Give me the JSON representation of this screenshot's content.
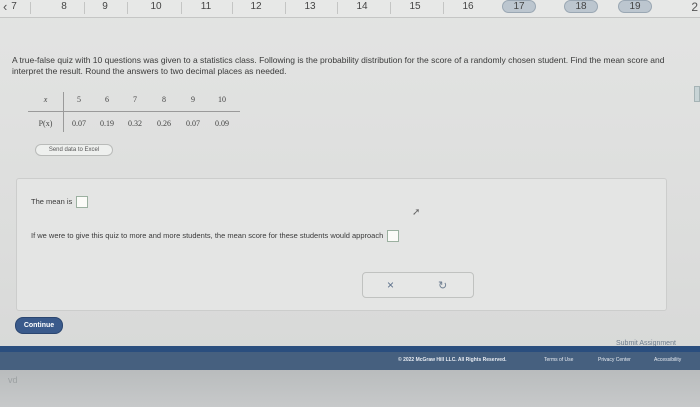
{
  "nav": {
    "prev_glyph": "‹",
    "items": [
      {
        "label": "7",
        "highlight": false
      },
      {
        "label": "8",
        "highlight": false
      },
      {
        "label": "9",
        "highlight": false
      },
      {
        "label": "10",
        "highlight": false
      },
      {
        "label": "11",
        "highlight": false
      },
      {
        "label": "12",
        "highlight": false
      },
      {
        "label": "13",
        "highlight": false
      },
      {
        "label": "14",
        "highlight": false
      },
      {
        "label": "15",
        "highlight": false
      },
      {
        "label": "16",
        "highlight": false
      },
      {
        "label": "17",
        "highlight": true
      },
      {
        "label": "18",
        "highlight": true
      },
      {
        "label": "19",
        "highlight": true
      }
    ],
    "next_glyph": "2"
  },
  "question": {
    "text": "A true-false quiz with 10 questions was given to a statistics class. Following is the probability distribution for the score of a randomly chosen student. Find the mean score and interpret the result. Round the answers to two decimal places as needed."
  },
  "table": {
    "x_label": "x",
    "p_label": "P(x)",
    "x_values": [
      "5",
      "6",
      "7",
      "8",
      "9",
      "10"
    ],
    "p_values": [
      "0.07",
      "0.19",
      "0.32",
      "0.26",
      "0.07",
      "0.09"
    ]
  },
  "excel_button": "Send data to Excel",
  "answer": {
    "mean_prefix": "The mean is",
    "approach_text": "If we were to give this quiz to more and more students, the mean score for these students would approach",
    "clear_glyph": "×",
    "redo_glyph": "↻"
  },
  "continue_label": "Continue",
  "submit_label": "Submit Assignment",
  "footer": {
    "copyright": "© 2022 McGraw Hill LLC. All Rights Reserved.",
    "terms": "Terms of Use",
    "privacy": "Privacy Center",
    "accessibility": "Accessibility"
  },
  "corner_text": "vd",
  "colors": {
    "accent_blue": "#2a4e7e",
    "continue_blue": "#3a5a8b",
    "answer_box_border": "#9bb0a0"
  }
}
